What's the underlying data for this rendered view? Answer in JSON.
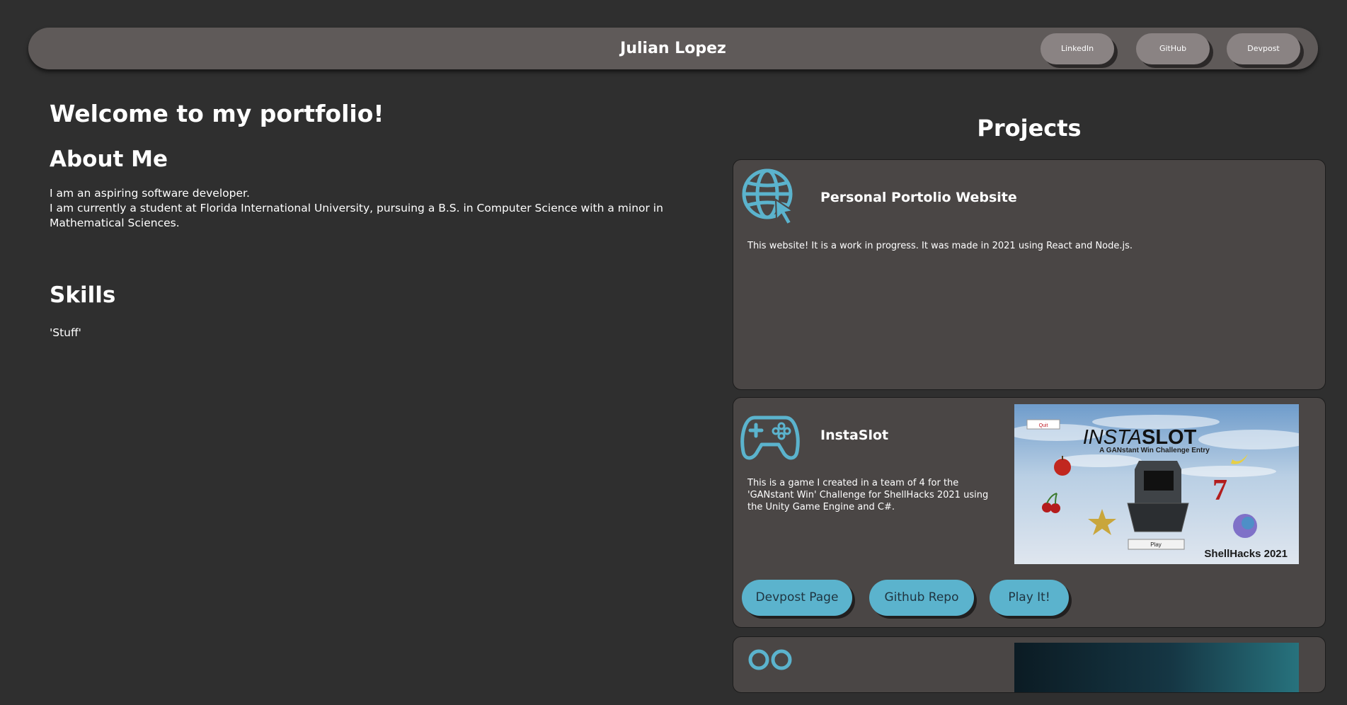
{
  "header": {
    "title": "Julian Lopez",
    "links": [
      "LinkedIn",
      "GitHub",
      "Devpost"
    ]
  },
  "left": {
    "welcome": "Welcome to my portfolio!",
    "about_title": "About Me",
    "about_lines": [
      "I am an aspiring software developer.",
      "I am currently a student at Florida International University, pursuing a B.S. in Computer Science with a minor in Mathematical Sciences."
    ],
    "skills_title": "Skills",
    "skills_text": "'Stuff'"
  },
  "projects": {
    "title": "Projects",
    "items": [
      {
        "icon": "globe-cursor-icon",
        "title": "Personal Portolio Website",
        "description": "This website! It is a work in progress. It was made in 2021 using React and Node.js."
      },
      {
        "icon": "gamepad-icon",
        "title": "InstaSlot",
        "description": "This is a game I created in a team of 4 for the 'GANstant Win' Challenge for ShellHacks 2021 using the Unity Game Engine and C#.",
        "screenshot": {
          "logo_left": "INSTA",
          "logo_right": "SLOT",
          "subtitle": "A GANstant Win Challenge Entry",
          "quit_label": "Quit",
          "play_label": "Play",
          "event": "ShellHacks 2021",
          "seven": "7"
        },
        "buttons": [
          "Devpost Page",
          "Github Repo",
          "Play It!"
        ]
      }
    ]
  },
  "colors": {
    "background": "#2f2f2f",
    "card": "#4a4645",
    "header": "#5f5a59",
    "accent": "#5bb3cd"
  }
}
